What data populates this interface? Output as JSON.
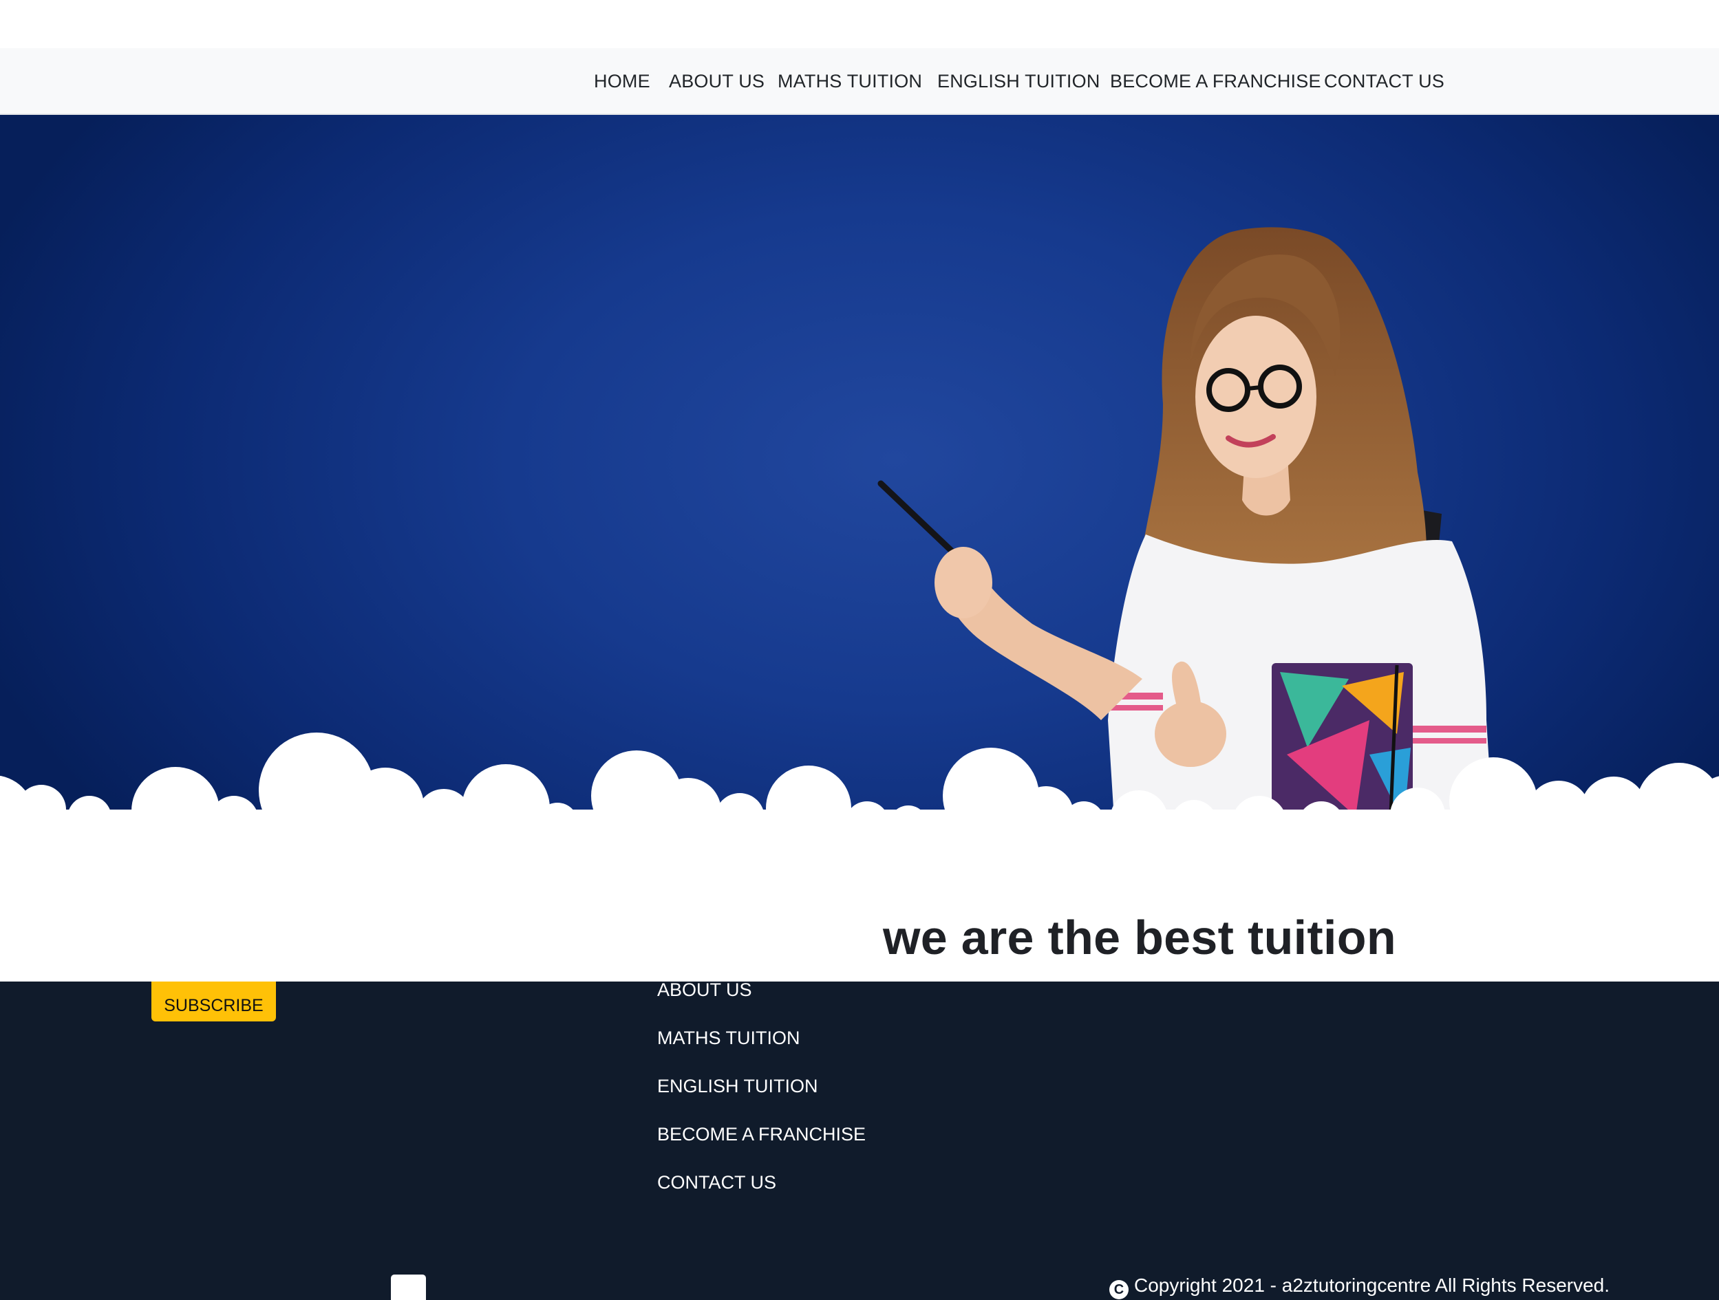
{
  "nav": {
    "items": [
      {
        "label": "HOME"
      },
      {
        "label": "ABOUT US"
      },
      {
        "label": "MATHS TUITION"
      },
      {
        "label": "ENGLISH TUITION"
      },
      {
        "label": "BECOME A FRANCHISE"
      },
      {
        "label": "CONTACT US"
      }
    ]
  },
  "hero": {
    "tagline": "we are the best tuition provider in city"
  },
  "footer": {
    "subscribe_label": "SUBSCRIBE",
    "links": [
      {
        "label": "ABOUT US"
      },
      {
        "label": "MATHS TUITION"
      },
      {
        "label": "ENGLISH TUITION"
      },
      {
        "label": "BECOME A FRANCHISE"
      },
      {
        "label": "CONTACT US"
      }
    ],
    "copyright": "Copyright 2021 - a2ztutoringcentre All Rights Reserved.",
    "copyright_icon": "copyright-icon"
  },
  "colors": {
    "navbar_bg": "#f8f9fa",
    "hero_blue": "#163a8e",
    "footer_bg": "#101b2b",
    "accent_yellow": "#ffc107"
  }
}
